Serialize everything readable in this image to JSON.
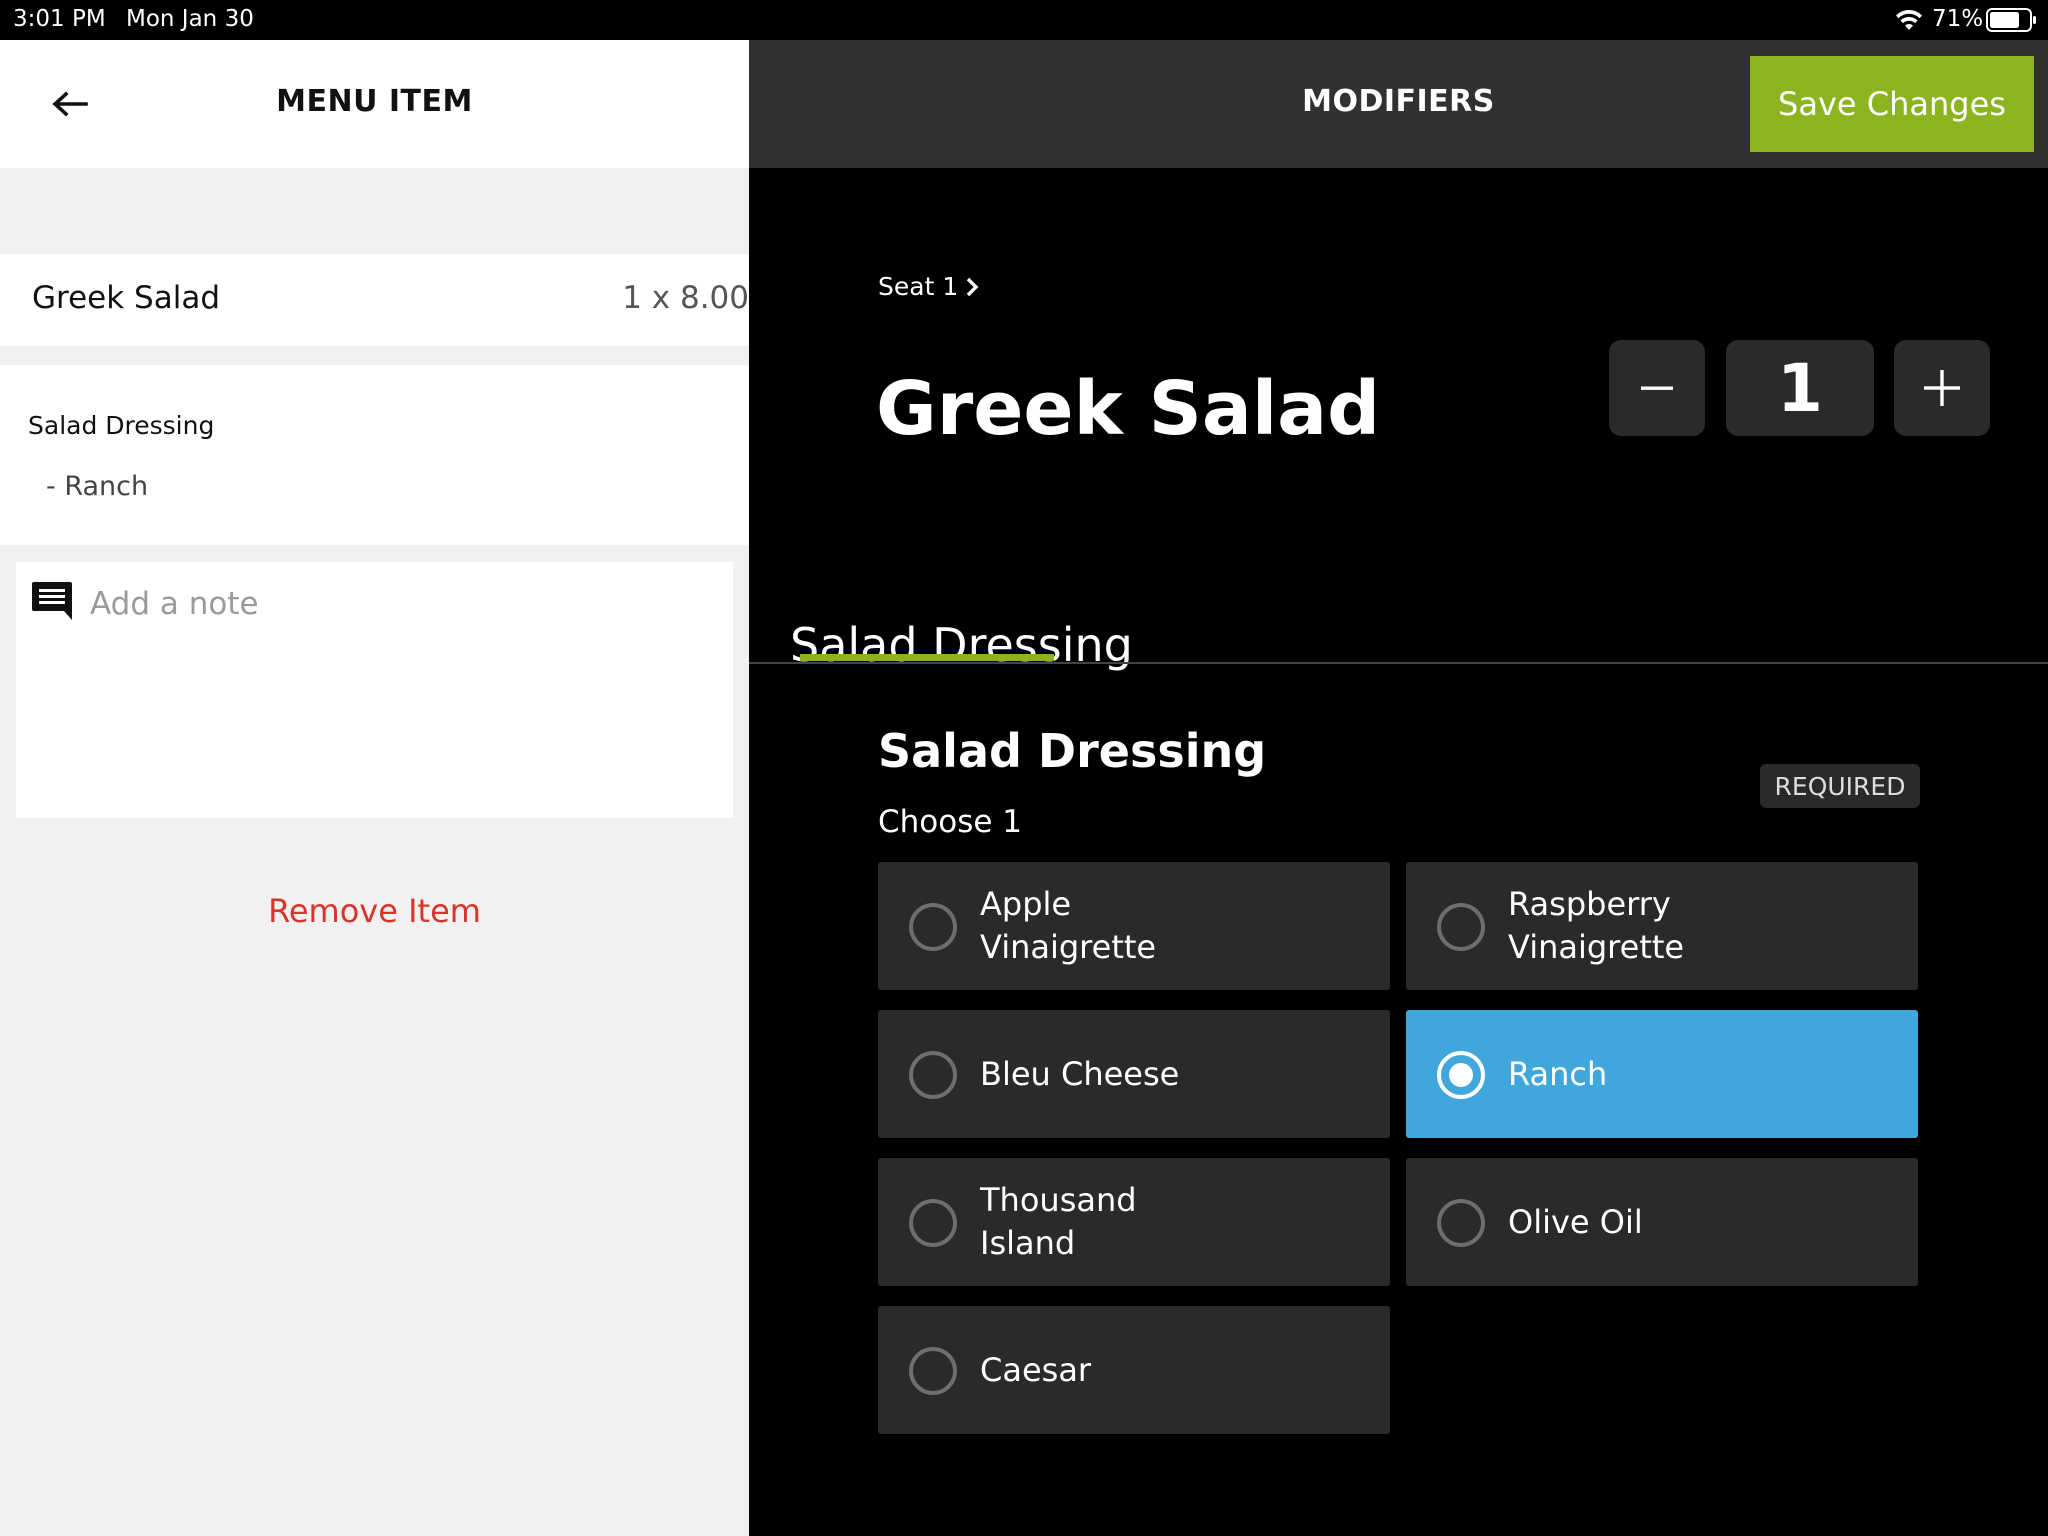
{
  "status_bar": {
    "time": "3:01 PM",
    "date": "Mon Jan 30",
    "battery_percent": "71%",
    "wifi_icon": "wifi-icon",
    "battery_icon": "battery-icon"
  },
  "left_panel": {
    "title": "MENU ITEM",
    "back_icon": "arrow-left-icon",
    "item": {
      "name": "Greek Salad",
      "price": "1 x 8.00"
    },
    "modifier_summary": {
      "group": "Salad Dressing",
      "choice": "- Ranch"
    },
    "note": {
      "icon": "comment-icon",
      "value": "",
      "placeholder": "Add a note"
    },
    "remove_label": "Remove Item"
  },
  "right_panel": {
    "title": "MODIFIERS",
    "save_label": "Save Changes",
    "seat_label": "Seat 1",
    "item_title": "Greek Salad",
    "quantity": {
      "minus_icon": "minus-icon",
      "value": "1",
      "plus_icon": "plus-icon"
    },
    "tabs": [
      {
        "label": "Salad Dressing",
        "active": true
      }
    ],
    "group": {
      "title": "Salad Dressing",
      "choose_text": "Choose  1",
      "required_label": "REQUIRED",
      "options": [
        {
          "label": "Apple\nVinaigrette",
          "selected": false
        },
        {
          "label": "Raspberry\nVinaigrette",
          "selected": false
        },
        {
          "label": "Bleu Cheese",
          "selected": false
        },
        {
          "label": "Ranch",
          "selected": true
        },
        {
          "label": "Thousand\nIsland",
          "selected": false
        },
        {
          "label": "Olive Oil",
          "selected": false
        },
        {
          "label": "Caesar",
          "selected": false
        }
      ]
    }
  },
  "colors": {
    "accent_green": "#8cb41f",
    "selected_blue": "#3fa7dc",
    "remove_red": "#d8352a",
    "dark_panel": "#313131",
    "option_bg": "#2a2a2a"
  }
}
